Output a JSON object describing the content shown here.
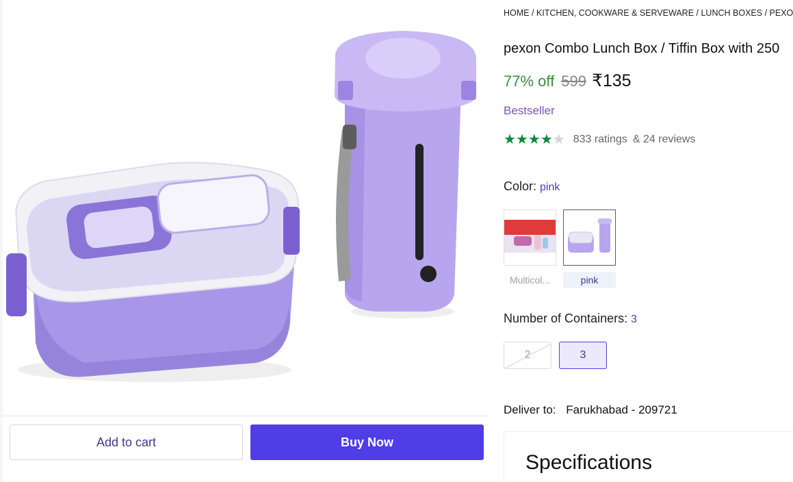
{
  "breadcrumb": [
    "HOME",
    "KITCHEN, COOKWARE & SERVEWARE",
    "LUNCH BOXES",
    "PEXON"
  ],
  "product": {
    "title": "pexon Combo Lunch Box / Tiffin Box with 250",
    "discount": "77% off",
    "mrp": "599",
    "price": "₹135",
    "badge": "Bestseller",
    "rating": 4,
    "rating_max": 5,
    "ratings_count": "833 ratings",
    "reviews_count": "& 24 reviews"
  },
  "color": {
    "label": "Color:",
    "selected": "pink",
    "options": [
      {
        "label": "Multicol..."
      },
      {
        "label": "pink"
      }
    ]
  },
  "containers": {
    "label": "Number of Containers:",
    "selected": "3",
    "options": [
      "2",
      "3"
    ]
  },
  "actions": {
    "add_to_cart": "Add to cart",
    "buy_now": "Buy Now"
  },
  "delivery": {
    "label": "Deliver to:",
    "location": "Farukhabad - 209721"
  },
  "specifications": {
    "title": "Specifications"
  },
  "colors": {
    "accent": "#4f3de6",
    "discount_green": "#388e3c",
    "star_green": "#0a8a3a",
    "product_lavender": "#b7a6ee"
  }
}
